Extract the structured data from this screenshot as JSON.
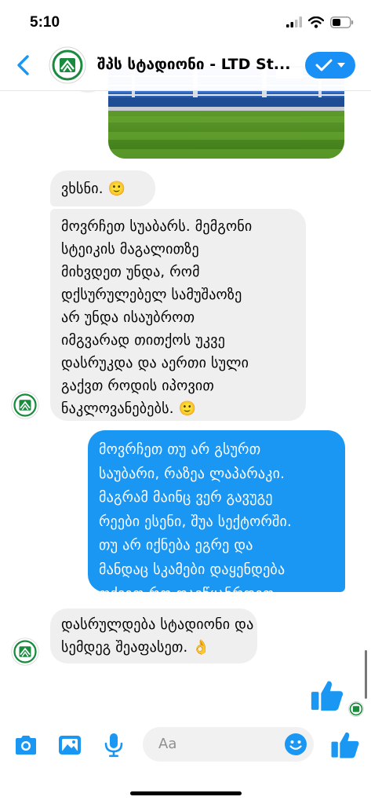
{
  "status_bar": {
    "time": "5:10",
    "icons": [
      "signal-icon",
      "wifi-icon",
      "battery-icon"
    ]
  },
  "header": {
    "title": "შპს სტადიონი - LTD St...",
    "back_icon": "chevron-left-icon",
    "action_icon": "checkmark-dropdown-icon"
  },
  "conversation": {
    "photo": {
      "description_icon": "stadium-photo"
    },
    "messages": [
      {
        "direction": "incoming",
        "lines": [
          "ვხსნი. 🙂"
        ]
      },
      {
        "direction": "incoming",
        "lines": [
          "მოვრჩეთ სუაბარს. მემგონი",
          "სტეიკის მაგალითზე",
          "მიხვდეთ უნდა, რომ",
          "დქსურულებელ სამუშაოზე",
          "არ უნდა ისაუბროთ",
          "იმგვარად თითქოს უკვე",
          "დასრუკდა და აერთი სული",
          "გაქვთ როდის იპოვით",
          "ნაკლოვანებებს. 🙂"
        ]
      },
      {
        "direction": "outgoing",
        "lines": [
          "მოვრჩეთ თუ არ გსურთ",
          "საუბარი, რაზეა ლაპარაკი.",
          "მაგრამ მაინც ვერ გავუგე",
          "რეები ესენი, შუა სექტორში.",
          "თუ არ იქნება ეგრე და",
          "მანდაც სკამები დაყენდება",
          "თქვით რო დავწყანრდეთ"
        ]
      },
      {
        "direction": "incoming",
        "lines": [
          "დასრულდება სტადიონი და",
          "სემდეგ შეაფასეთ. 👌"
        ]
      }
    ],
    "sent_like_icon": "thumbs-up-icon"
  },
  "composer": {
    "placeholder": "Aa",
    "icons": [
      "camera-icon",
      "gallery-icon",
      "microphone-icon",
      "emoji-icon",
      "thumbs-up-icon"
    ]
  },
  "colors": {
    "accent": "#1a97f3",
    "incoming_bubble": "#efefef",
    "logo_green": "#1a8a3e"
  }
}
